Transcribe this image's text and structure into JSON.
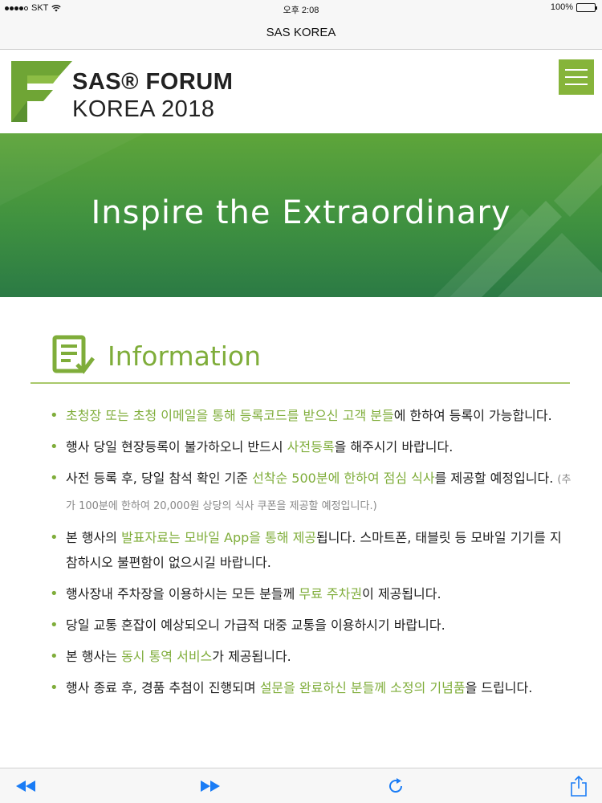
{
  "status_bar": {
    "carrier": "SKT",
    "time": "오후 2:08",
    "battery": "100%",
    "battery_level": 1.0
  },
  "browser": {
    "address_title": "SAS KOREA"
  },
  "header": {
    "logo_line1": "SAS® FORUM",
    "logo_line2": "KOREA 2018"
  },
  "hero": {
    "title": "Inspire the Extraordinary"
  },
  "info": {
    "title": "Information",
    "items": [
      {
        "parts": [
          {
            "t": "초청장 또는 초청 이메일을 통해 등록코드를 받으신 고객 분들",
            "hl": true
          },
          {
            "t": "에 한하여 등록이 가능합니다."
          }
        ]
      },
      {
        "parts": [
          {
            "t": "행사 당일 현장등록이 불가하오니 반드시 "
          },
          {
            "t": "사전등록",
            "hl": true
          },
          {
            "t": "을 해주시기 바랍니다."
          }
        ]
      },
      {
        "parts": [
          {
            "t": "사전 등록 후, 당일 참석 확인 기준 "
          },
          {
            "t": "선착순 500분에 한하여 점심 식사",
            "hl": true
          },
          {
            "t": "를 제공할 예정입니다. "
          },
          {
            "t": "(추가 100분에 한하여 20,000원 상당의 식사 쿠폰을 제공할 예정입니다.)",
            "note": true
          }
        ]
      },
      {
        "parts": [
          {
            "t": "본 행사의 "
          },
          {
            "t": "발표자료는 모바일 App을 통해 제공",
            "hl": true
          },
          {
            "t": "됩니다. 스마트폰, 태블릿 등 모바일 기기를 지참하시오 불편함이 없으시길 바랍니다."
          }
        ]
      },
      {
        "parts": [
          {
            "t": "행사장내 주차장을 이용하시는 모든 분들께 "
          },
          {
            "t": "무료 주차권",
            "hl": true
          },
          {
            "t": "이 제공됩니다."
          }
        ]
      },
      {
        "parts": [
          {
            "t": "당일 교통 혼잡이 예상되오니 가급적 대중 교통을 이용하시기 바랍니다."
          }
        ]
      },
      {
        "parts": [
          {
            "t": "본 행사는 "
          },
          {
            "t": "동시 통역 서비스",
            "hl": true
          },
          {
            "t": "가 제공됩니다."
          }
        ]
      },
      {
        "parts": [
          {
            "t": "행사 종료 후, 경품 추첨이 진행되며 "
          },
          {
            "t": "설문을 완료하신 분들께 소정의 기념품",
            "hl": true
          },
          {
            "t": "을 드립니다."
          }
        ]
      }
    ]
  },
  "colors": {
    "accent": "#7fad3a",
    "menu": "#86b43a",
    "hero_top": "#5ea53a",
    "hero_bottom": "#2b7a45",
    "ios_blue": "#1a7cf5"
  },
  "toolbar": {
    "icons": [
      "back-icon",
      "forward-icon",
      "reload-icon",
      "share-icon"
    ]
  }
}
